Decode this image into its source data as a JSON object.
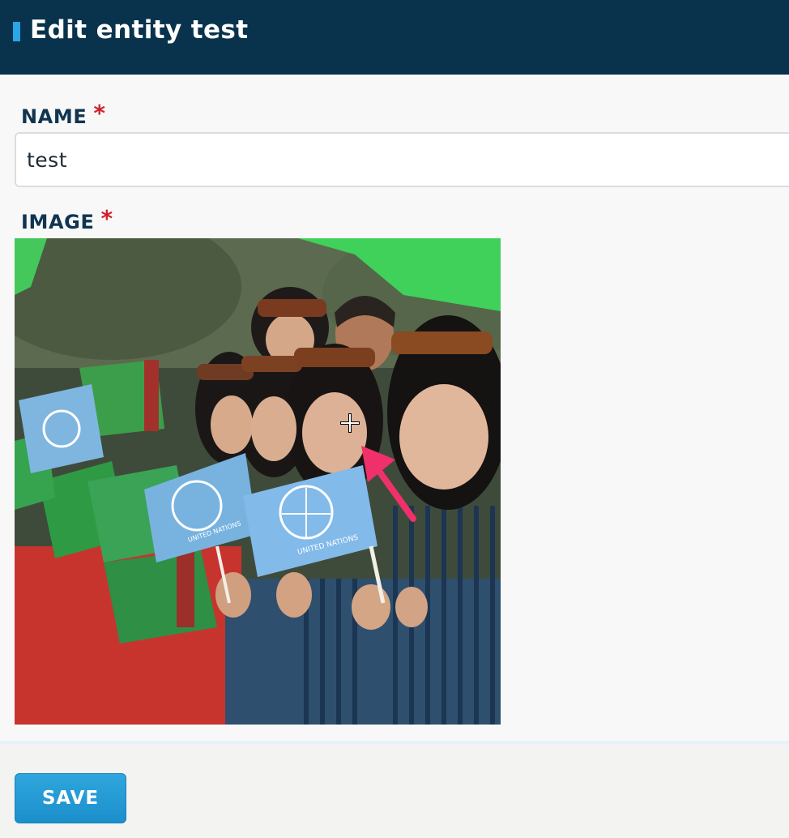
{
  "header": {
    "title": "Edit entity test",
    "accent_color": "#2aa5e6",
    "background_color": "#09334c"
  },
  "form": {
    "name_label": "NAME",
    "name_required": "*",
    "name_value": "test",
    "image_label": "IMAGE",
    "image_required": "*",
    "image_alt": "Uploaded entity image: people holding United Nations and Turkmenistan flags",
    "flag_text": "UNITED NATIONS"
  },
  "footer": {
    "save_label": "SAVE",
    "button_color": "#2aa5e6"
  },
  "icons": {
    "cursor": "crosshair-cursor-icon",
    "annotation": "arrow-annotation-icon"
  },
  "colors": {
    "required": "#d21f2b",
    "label": "#0f3550",
    "arrow": "#f0306b"
  }
}
